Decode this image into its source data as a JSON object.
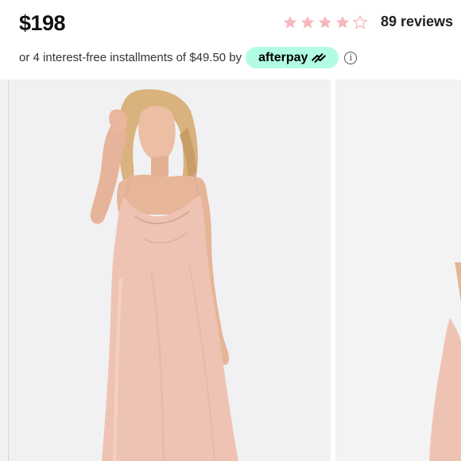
{
  "product": {
    "price": "$198",
    "rating": 4,
    "max_rating": 5,
    "reviews_label": "89 reviews"
  },
  "installments": {
    "prefix_text": "or 4 interest-free installments of $49.50 by",
    "provider_label": "afterpay",
    "info_icon": "info-icon"
  },
  "colors": {
    "star_filled": "#f6b8bd",
    "star_empty": "#f6b8bd",
    "afterpay_mint": "#b2fce4",
    "dress": "#efc3b3"
  },
  "gallery": {
    "image_count_visible": 2,
    "main_image": "model-wearing-blush-satin-slip-dress",
    "second_image": "partial-view-blush-satin-slip-dress"
  }
}
